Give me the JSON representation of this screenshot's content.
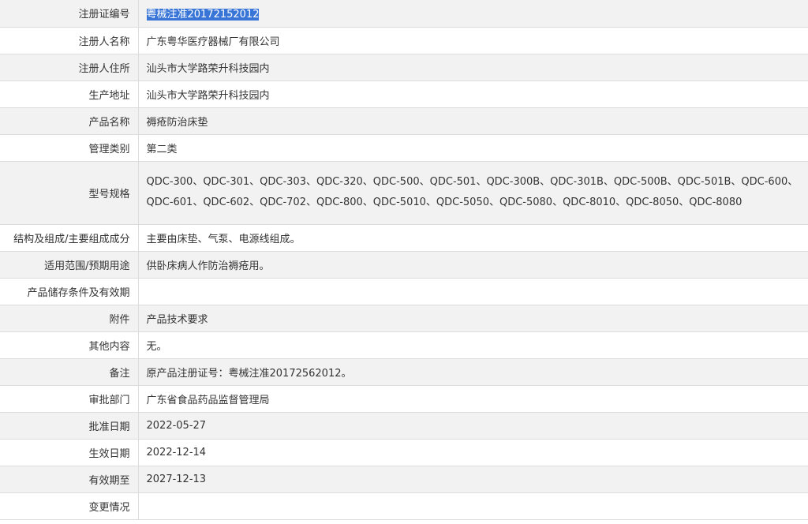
{
  "rows": [
    {
      "label": "注册证编号",
      "value": "粤械注准20172152012",
      "highlight": true
    },
    {
      "label": "注册人名称",
      "value": "广东粤华医疗器械厂有限公司"
    },
    {
      "label": "注册人住所",
      "value": "汕头市大学路荣升科技园内"
    },
    {
      "label": "生产地址",
      "value": "汕头市大学路荣升科技园内"
    },
    {
      "label": "产品名称",
      "value": "褥疮防治床垫"
    },
    {
      "label": "管理类别",
      "value": "第二类"
    },
    {
      "label": "型号规格",
      "value": "QDC-300、QDC-301、QDC-303、QDC-320、QDC-500、QDC-501、QDC-300B、QDC-301B、QDC-500B、QDC-501B、QDC-600、QDC-601、QDC-602、QDC-702、QDC-800、QDC-5010、QDC-5050、QDC-5080、QDC-8010、QDC-8050、QDC-8080",
      "tall": true
    },
    {
      "label": "结构及组成/主要组成成分",
      "value": "主要由床垫、气泵、电源线组成。"
    },
    {
      "label": "适用范围/预期用途",
      "value": "供卧床病人作防治褥疮用。"
    },
    {
      "label": "产品储存条件及有效期",
      "value": ""
    },
    {
      "label": "附件",
      "value": "产品技术要求"
    },
    {
      "label": "其他内容",
      "value": "无。"
    },
    {
      "label": "备注",
      "value": "原产品注册证号：粤械注准20172562012。"
    },
    {
      "label": "审批部门",
      "value": "广东省食品药品监督管理局"
    },
    {
      "label": "批准日期",
      "value": "2022-05-27"
    },
    {
      "label": "生效日期",
      "value": "2022-12-14"
    },
    {
      "label": "有效期至",
      "value": "2027-12-13"
    },
    {
      "label": "变更情况",
      "value": ""
    }
  ],
  "colors": {
    "row_alt": "#f2f2f2",
    "border": "#dcdcdc",
    "selection": "#3875d7"
  }
}
